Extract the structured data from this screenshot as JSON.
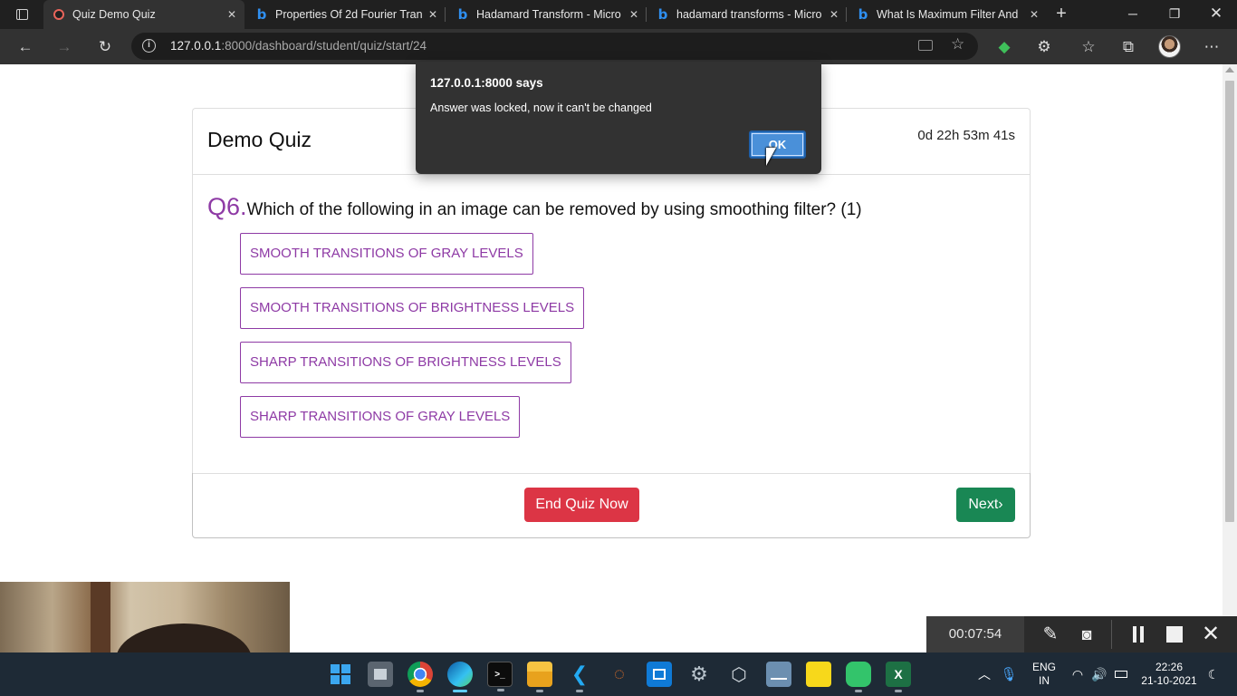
{
  "browser": {
    "tabs": [
      {
        "title": "Quiz Demo Quiz",
        "active": true
      },
      {
        "title": "Properties Of 2d Fourier Tran"
      },
      {
        "title": "Hadamard Transform - Micro"
      },
      {
        "title": "hadamard transforms - Micro"
      },
      {
        "title": "What Is Maximum Filter And"
      }
    ],
    "url_host": "127.0.0.1",
    "url_rest": ":8000/dashboard/student/quiz/start/24"
  },
  "quiz": {
    "title": "Demo Quiz",
    "timer": "0d 22h 53m 41s",
    "question_number": "Q6.",
    "question_text": "Which of the following in an image can be removed by using smoothing filter? (1)",
    "options": [
      "SMOOTH TRANSITIONS OF GRAY LEVELS",
      "SMOOTH TRANSITIONS OF BRIGHTNESS LEVELS",
      "SHARP TRANSITIONS OF BRIGHTNESS LEVELS",
      "SHARP TRANSITIONS OF GRAY LEVELS"
    ],
    "end_button": "End Quiz Now",
    "next_button": "Next›"
  },
  "alert": {
    "title": "127.0.0.1:8000 says",
    "message": "Answer was locked, now it can't be changed",
    "ok": "OK"
  },
  "recorder": {
    "time": "00:07:54"
  },
  "taskbar": {
    "lang_top": "ENG",
    "lang_bottom": "IN",
    "clock_time": "22:26",
    "clock_date": "21-10-2021"
  },
  "colors": {
    "accent_purple": "#8e3aa5",
    "danger": "#dc3545",
    "success": "#198754",
    "dialog_bg": "#323232"
  }
}
